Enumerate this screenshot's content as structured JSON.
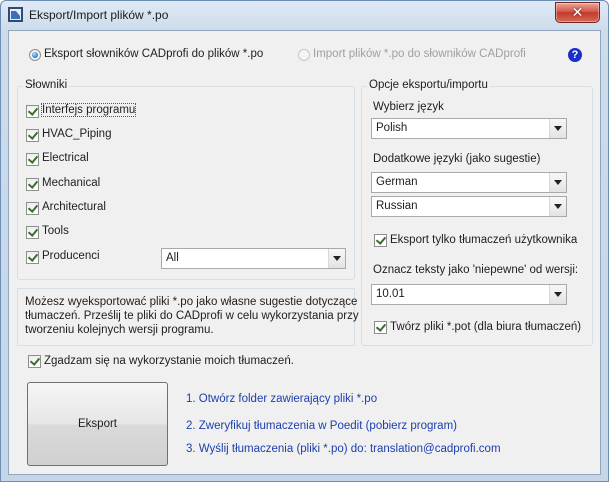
{
  "window": {
    "title": "Eksport/Import plików *.po",
    "close_label": "✕"
  },
  "mode": {
    "export_label": "Eksport słowników CADprofi do plików *.po",
    "import_label": "Import plików *.po do słowników CADprofi",
    "help": "?"
  },
  "dictionaries": {
    "title": "Słowniki",
    "items": [
      {
        "label": "Interfejs programu",
        "checked": true
      },
      {
        "label": "HVAC_Piping",
        "checked": true
      },
      {
        "label": "Electrical",
        "checked": true
      },
      {
        "label": "Mechanical",
        "checked": true
      },
      {
        "label": "Architectural",
        "checked": true
      },
      {
        "label": "Tools",
        "checked": true
      },
      {
        "label": "Producenci",
        "checked": true
      }
    ],
    "producers_select": "All"
  },
  "options": {
    "title": "Opcje eksportu/importu",
    "language_label": "Wybierz język",
    "language_value": "Polish",
    "extra_label": "Dodatkowe języki (jako sugestie)",
    "extra_1": "German",
    "extra_2": "Russian",
    "only_user_label": "Eksport tylko tłumaczeń użytkownika",
    "uncertain_label": "Oznacz teksty jako 'niepewne' od wersji:",
    "version_value": "10.01",
    "pot_label": "Twórz pliki *.pot (dla biura tłumaczeń)"
  },
  "info": {
    "line1": "Możesz wyeksportować pliki *.po jako własne sugestie dotyczące",
    "line2": "tłumaczeń.  Prześlij te pliki do CADprofi w celu wykorzystania przy",
    "line3": "tworzeniu kolejnych wersji programu."
  },
  "agree_label": "Zgadzam się na wykorzystanie moich tłumaczeń.",
  "export_button": "Eksport",
  "steps": {
    "step1": "1. Otwórz folder zawierający pliki *.po",
    "step2": "2. Zweryfikuj tłumaczenia w Poedit (pobierz program)",
    "step3": "3. Wyślij tłumaczenia (pliki *.po) do: translation@cadprofi.com"
  },
  "colors": {
    "link": "#1d3fae",
    "help": "#1a2fc7",
    "close": "#c23a2c"
  }
}
